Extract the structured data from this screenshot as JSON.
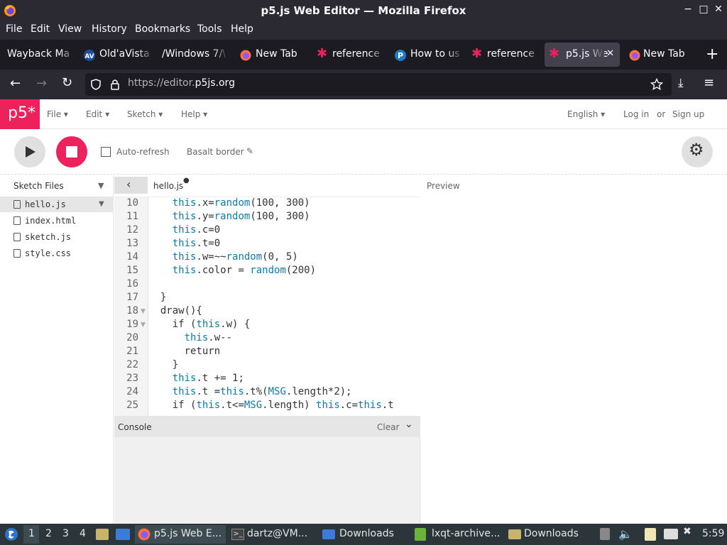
{
  "window": {
    "title": "p5.js Web Editor — Mozilla Firefox"
  },
  "menubar": [
    "File",
    "Edit",
    "View",
    "History",
    "Bookmarks",
    "Tools",
    "Help"
  ],
  "tabs": [
    {
      "label": "Wayback Ma",
      "icon": "none-icon"
    },
    {
      "label": "Old'aVista",
      "icon": "av-icon"
    },
    {
      "label": "/Windows 7/\\",
      "icon": "none-icon"
    },
    {
      "label": "New Tab",
      "icon": "firefox-icon"
    },
    {
      "label": "reference",
      "icon": "p5-star-icon"
    },
    {
      "label": "How to us",
      "icon": "p-icon"
    },
    {
      "label": "reference",
      "icon": "p5-star-icon"
    },
    {
      "label": "p5.js We",
      "icon": "p5-star-icon",
      "active": true
    },
    {
      "label": "New Tab",
      "icon": "firefox-icon"
    }
  ],
  "nav": {
    "url_dim": "https://editor.",
    "url_main": "p5js.org"
  },
  "p5": {
    "logo": "p5*",
    "menus": [
      "File",
      "Edit",
      "Sketch",
      "Help"
    ],
    "language": "English",
    "login": "Log in",
    "or": "or",
    "signup": "Sign up",
    "auto_refresh": "Auto-refresh",
    "sketch_name": "Basalt border",
    "sidebar_title": "Sketch Files",
    "files": [
      "hello.js",
      "index.html",
      "sketch.js",
      "style.css"
    ],
    "active_file": "hello.js",
    "preview_label": "Preview",
    "console_label": "Console",
    "clear_label": "Clear"
  },
  "code": {
    "line_numbers": [
      "10",
      "11",
      "12",
      "13",
      "14",
      "15",
      "16",
      "17",
      "18",
      "19",
      "20",
      "21",
      "22",
      "23",
      "24",
      "25"
    ],
    "lines": [
      "    this.x=random(100, 300)",
      "    this.y=random(100, 300)",
      "    this.c=0",
      "    this.t=0",
      "    this.w=~~random(0, 5)",
      "    this.color = random(200)",
      "",
      "  }",
      "  draw(){",
      "    if (this.w) {",
      "      this.w--",
      "      return",
      "    }",
      "    this.t += 1;",
      "    this.t =this.t%(MSG.length*2);",
      "    if (this.t<=MSG.length) this.c=this.t"
    ]
  },
  "taskbar": {
    "workspaces": [
      "1",
      "2",
      "3",
      "4"
    ],
    "items": [
      "p5.js Web E...",
      "dartz@VM...",
      "Downloads",
      "lxqt-archive...",
      "Downloads"
    ],
    "clock": "5:59"
  }
}
